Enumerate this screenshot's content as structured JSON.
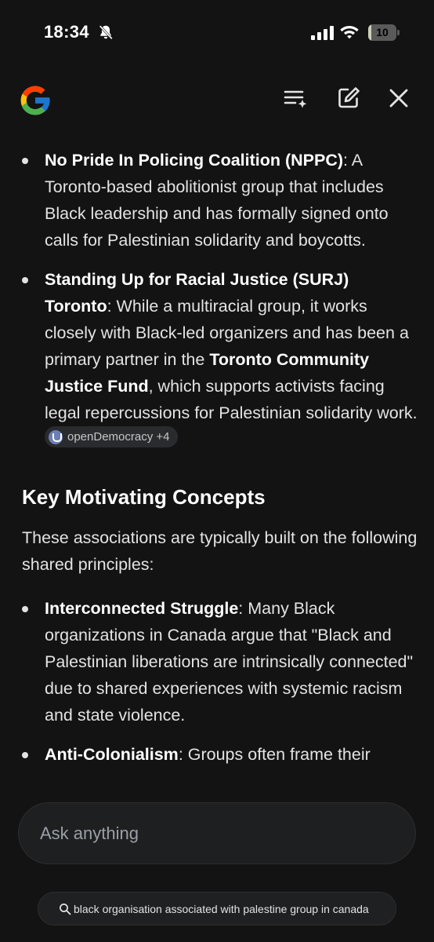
{
  "status_bar": {
    "time": "18:34",
    "battery": "10",
    "battery_fraction": 0.1
  },
  "content": {
    "bullet1": {
      "bold": "No Pride In Policing Coalition (NPPC)",
      "text": ": A Toronto-based abolitionist group that includes Black leadership and has formally signed onto calls for Palestinian solidarity and boycotts."
    },
    "bullet2": {
      "bold": "Standing Up for Racial Justice (SURJ) Toronto",
      "text1": ": While a multiracial group, it works closely with Black-led organizers and has been a primary partner in the ",
      "bold2": "Toronto Community Justice Fund",
      "text2": ", which supports activists facing legal repercussions for Palestinian solidarity work.",
      "source_chip": "openDemocracy +4"
    },
    "heading": "Key Motivating Concepts",
    "paragraph": "These associations are typically built on the following shared principles:",
    "bullet3": {
      "bold": "Interconnected Struggle",
      "text": ": Many Black organizations in Canada argue that \"Black and Palestinian liberations are intrinsically connected\" due to shared experiences with systemic racism and state violence."
    },
    "bullet4": {
      "bold": "Anti-Colonialism",
      "text": ": Groups often frame their"
    }
  },
  "ask": {
    "placeholder": "Ask anything"
  },
  "query": {
    "text": "black organisation associated with palestine group in canada"
  },
  "colors": {
    "background": "#131314",
    "text": "#e3e3e3",
    "surface": "#1e1f20"
  }
}
